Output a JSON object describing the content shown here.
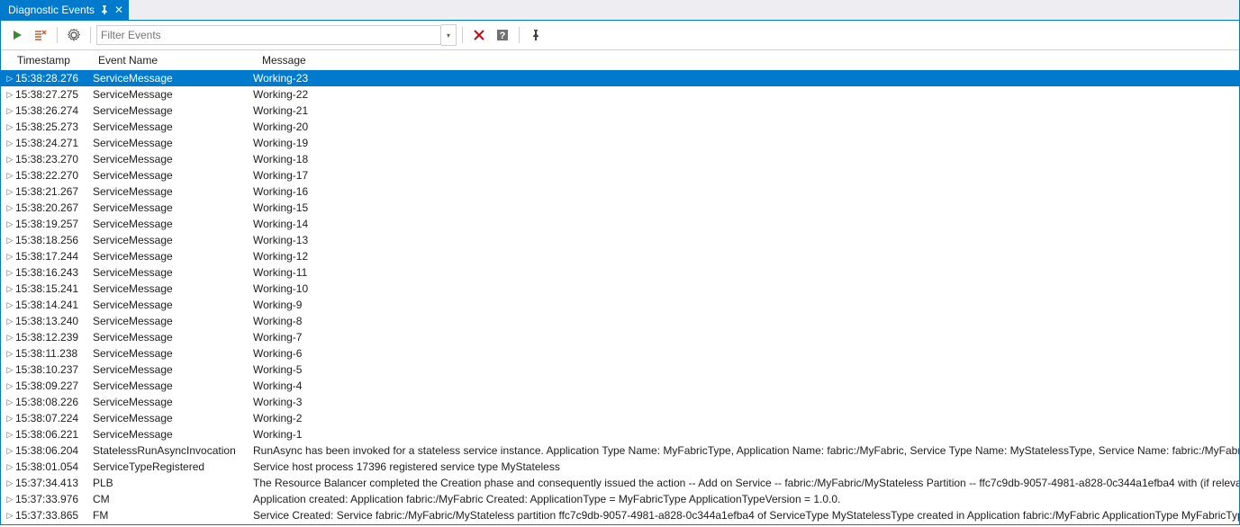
{
  "tab": {
    "title": "Diagnostic Events"
  },
  "toolbar": {
    "play_color": "#388a34",
    "clear_color": "#c0622e",
    "gear_color": "#424242",
    "filter_placeholder": "Filter Events",
    "clear_filter_color": "#c50b17",
    "help_bg": "#717171",
    "pin_color": "#424242"
  },
  "columns": {
    "timestamp": "Timestamp",
    "event_name": "Event Name",
    "message": "Message"
  },
  "events": [
    {
      "ts": "15:38:28.276",
      "name": "ServiceMessage",
      "msg": "Working-23",
      "selected": true
    },
    {
      "ts": "15:38:27.275",
      "name": "ServiceMessage",
      "msg": "Working-22"
    },
    {
      "ts": "15:38:26.274",
      "name": "ServiceMessage",
      "msg": "Working-21"
    },
    {
      "ts": "15:38:25.273",
      "name": "ServiceMessage",
      "msg": "Working-20"
    },
    {
      "ts": "15:38:24.271",
      "name": "ServiceMessage",
      "msg": "Working-19"
    },
    {
      "ts": "15:38:23.270",
      "name": "ServiceMessage",
      "msg": "Working-18"
    },
    {
      "ts": "15:38:22.270",
      "name": "ServiceMessage",
      "msg": "Working-17"
    },
    {
      "ts": "15:38:21.267",
      "name": "ServiceMessage",
      "msg": "Working-16"
    },
    {
      "ts": "15:38:20.267",
      "name": "ServiceMessage",
      "msg": "Working-15"
    },
    {
      "ts": "15:38:19.257",
      "name": "ServiceMessage",
      "msg": "Working-14"
    },
    {
      "ts": "15:38:18.256",
      "name": "ServiceMessage",
      "msg": "Working-13"
    },
    {
      "ts": "15:38:17.244",
      "name": "ServiceMessage",
      "msg": "Working-12"
    },
    {
      "ts": "15:38:16.243",
      "name": "ServiceMessage",
      "msg": "Working-11"
    },
    {
      "ts": "15:38:15.241",
      "name": "ServiceMessage",
      "msg": "Working-10"
    },
    {
      "ts": "15:38:14.241",
      "name": "ServiceMessage",
      "msg": "Working-9"
    },
    {
      "ts": "15:38:13.240",
      "name": "ServiceMessage",
      "msg": "Working-8"
    },
    {
      "ts": "15:38:12.239",
      "name": "ServiceMessage",
      "msg": "Working-7"
    },
    {
      "ts": "15:38:11.238",
      "name": "ServiceMessage",
      "msg": "Working-6"
    },
    {
      "ts": "15:38:10.237",
      "name": "ServiceMessage",
      "msg": "Working-5"
    },
    {
      "ts": "15:38:09.227",
      "name": "ServiceMessage",
      "msg": "Working-4"
    },
    {
      "ts": "15:38:08.226",
      "name": "ServiceMessage",
      "msg": "Working-3"
    },
    {
      "ts": "15:38:07.224",
      "name": "ServiceMessage",
      "msg": "Working-2"
    },
    {
      "ts": "15:38:06.221",
      "name": "ServiceMessage",
      "msg": "Working-1"
    },
    {
      "ts": "15:38:06.204",
      "name": "StatelessRunAsyncInvocation",
      "msg": "RunAsync has been invoked for a stateless service instance.  Application Type Name: MyFabricType, Application Name: fabric:/MyFabric, Service Type Name: MyStatelessType, Service Name: fabric:/MyFabric/I"
    },
    {
      "ts": "15:38:01.054",
      "name": "ServiceTypeRegistered",
      "msg": "Service host process 17396 registered service type MyStateless"
    },
    {
      "ts": "15:37:34.413",
      "name": "PLB",
      "msg": "The Resource Balancer completed the Creation phase and consequently issued the action -- Add on Service -- fabric:/MyFabric/MyStateless Partition -- ffc7c9db-9057-4981-a828-0c344a1efba4 with (if relevant)"
    },
    {
      "ts": "15:37:33.976",
      "name": "CM",
      "msg": "Application created: Application fabric:/MyFabric Created: ApplicationType = MyFabricType ApplicationTypeVersion = 1.0.0."
    },
    {
      "ts": "15:37:33.865",
      "name": "FM",
      "msg": "Service Created: Service fabric:/MyFabric/MyStateless partition ffc7c9db-9057-4981-a828-0c344a1efba4 of ServiceType MyStatelessType created in Application fabric:/MyFabric ApplicationType MyFabricType."
    }
  ]
}
